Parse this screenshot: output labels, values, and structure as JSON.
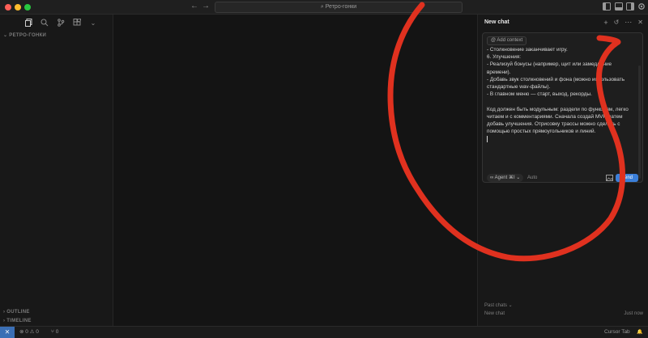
{
  "window": {
    "search_title": "⌕ Ретро-гонки"
  },
  "sidebar": {
    "explorer_title": "⌄ РЕТРО-ГОНКИ",
    "outline_label": "› OUTLINE",
    "timeline_label": "› TIMELINE"
  },
  "chat": {
    "title": "New chat",
    "add_context_label": "@ Add context",
    "lines": [
      "    - Столкновение заканчивает игру.",
      "6. Улучшения:",
      "    - Реализуй бонусы (например, щит или замедление",
      "времени).",
      "    - Добавь звук столкновений и фона (можно использовать",
      "стандартные wav-файлы).",
      "    - В главном меню — старт, выход, рекорды.",
      "",
      "Код должен быть модульным: раздели по функциям, легко",
      "читаем и с комментариями. Сначала создай MVP, затем",
      "добавь улучшения. Отрисовку трассы можно сделать с",
      "помощью простых прямоугольников и линий."
    ],
    "agent_label": "∞ Agent ⌘I ⌄",
    "mode_label": "Auto",
    "send_label": "Send",
    "past_chats_label": "Past chats ⌄",
    "past_chat_title": "New chat",
    "past_chat_time": "Just now"
  },
  "statusbar": {
    "remote_icon": "⨯",
    "problems": "⊗ 0 ⚠ 0",
    "ports": "⑂ 0",
    "cursor_tab": "Cursor Tab",
    "bell": "🔔"
  },
  "colors": {
    "accent": "#3b7fd9",
    "annotation": "#e0311f"
  }
}
